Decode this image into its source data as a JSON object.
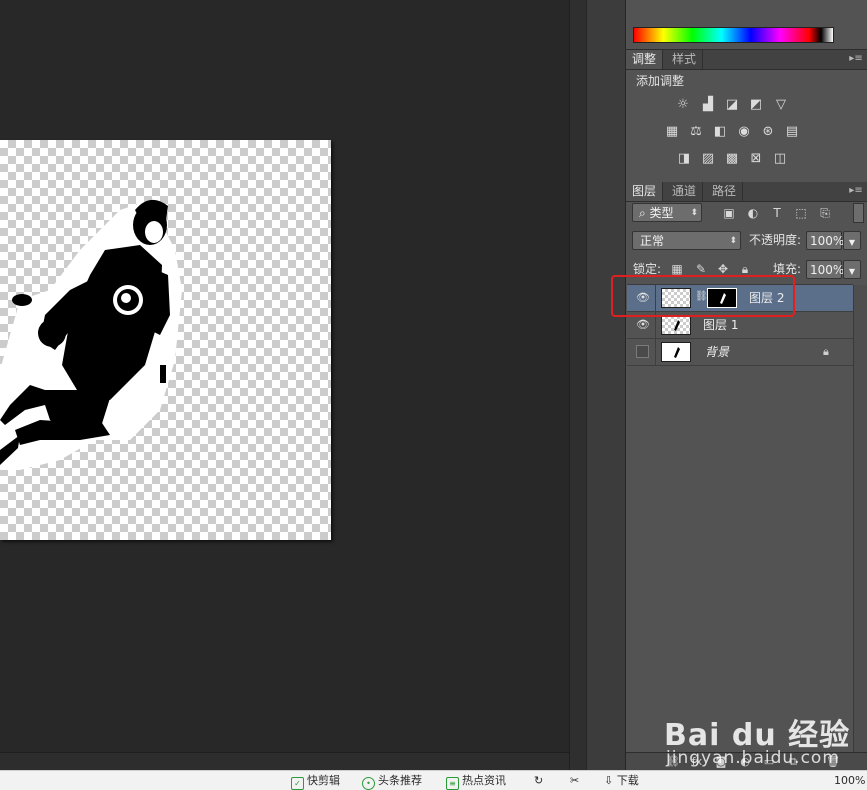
{
  "adjustments_panel": {
    "tabs": [
      "调整",
      "样式"
    ],
    "title": "添加调整"
  },
  "layers_panel": {
    "tabs": [
      "图层",
      "通道",
      "路径"
    ],
    "filter_kind": "类型",
    "blend_mode": "正常",
    "opacity_label": "不透明度:",
    "opacity_value": "100%",
    "lock_label": "锁定:",
    "fill_label": "填充:",
    "fill_value": "100%",
    "layers": [
      {
        "name": "图层 2",
        "visible": true,
        "selected": true,
        "has_mask": true
      },
      {
        "name": "图层 1",
        "visible": true,
        "selected": false,
        "has_mask": false
      },
      {
        "name": "背景",
        "visible": false,
        "selected": false,
        "locked": true
      }
    ]
  },
  "taskbar": {
    "items": [
      "快剪辑",
      "头条推荐",
      "热点资讯",
      "下载",
      "100%"
    ]
  },
  "watermark": {
    "brand_text": "Bai du 经验",
    "domain_text": "jingyan.baidu.com"
  },
  "colors": {
    "panel_bg": "#535353",
    "workspace_bg": "#282828",
    "selected_layer": "#5b6f8a",
    "highlight_red": "#e02020"
  }
}
